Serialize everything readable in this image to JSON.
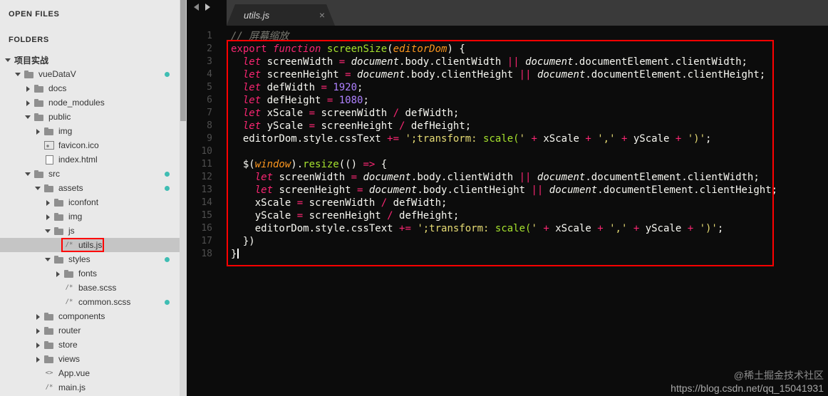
{
  "colors": {
    "annotation_red": "#ff0000",
    "modified_dot_teal": "#3fbdb3",
    "code_bg": "#0c0c0c",
    "sidebar_bg": "#e9e9e9"
  },
  "sidebar": {
    "open_files_label": "OPEN FILES",
    "folders_label": "FOLDERS",
    "tree": [
      {
        "label": "项目实战",
        "level": 0,
        "type": "root",
        "state": "open"
      },
      {
        "label": "vueDataV",
        "level": 1,
        "type": "folder",
        "state": "open",
        "dot": true
      },
      {
        "label": "docs",
        "level": 2,
        "type": "folder",
        "state": "closed"
      },
      {
        "label": "node_modules",
        "level": 2,
        "type": "folder",
        "state": "closed"
      },
      {
        "label": "public",
        "level": 2,
        "type": "folder",
        "state": "open"
      },
      {
        "label": "img",
        "level": 3,
        "type": "folder",
        "state": "closed"
      },
      {
        "label": "favicon.ico",
        "level": 3,
        "type": "file",
        "icon": "image"
      },
      {
        "label": "index.html",
        "level": 3,
        "type": "file",
        "icon": "file"
      },
      {
        "label": "src",
        "level": 2,
        "type": "folder",
        "state": "open",
        "dot": true
      },
      {
        "label": "assets",
        "level": 3,
        "type": "folder",
        "state": "open",
        "dot": true
      },
      {
        "label": "iconfont",
        "level": 4,
        "type": "folder",
        "state": "closed"
      },
      {
        "label": "img",
        "level": 4,
        "type": "folder",
        "state": "closed"
      },
      {
        "label": "js",
        "level": 4,
        "type": "folder",
        "state": "open"
      },
      {
        "label": "utils.js",
        "level": 5,
        "type": "file",
        "icon": "slashstar",
        "selected": true,
        "annotated": true
      },
      {
        "label": "styles",
        "level": 4,
        "type": "folder",
        "state": "open",
        "dot": true
      },
      {
        "label": "fonts",
        "level": 5,
        "type": "folder",
        "state": "closed"
      },
      {
        "label": "base.scss",
        "level": 5,
        "type": "file",
        "icon": "slashstar"
      },
      {
        "label": "common.scss",
        "level": 5,
        "type": "file",
        "icon": "slashstar",
        "dot": true
      },
      {
        "label": "components",
        "level": 3,
        "type": "folder",
        "state": "closed"
      },
      {
        "label": "router",
        "level": 3,
        "type": "folder",
        "state": "closed"
      },
      {
        "label": "store",
        "level": 3,
        "type": "folder",
        "state": "closed"
      },
      {
        "label": "views",
        "level": 3,
        "type": "folder",
        "state": "closed"
      },
      {
        "label": "App.vue",
        "level": 3,
        "type": "file",
        "icon": "angle"
      },
      {
        "label": "main.js",
        "level": 3,
        "type": "file",
        "icon": "slashstar"
      }
    ]
  },
  "editor": {
    "tab": {
      "title": "utils.js",
      "close_glyph": "×"
    },
    "code": {
      "caret_line": 18,
      "lines": [
        [
          [
            "c",
            "// 屏幕缩放"
          ]
        ],
        [
          [
            "k",
            "export "
          ],
          [
            "ki",
            "function "
          ],
          [
            "f",
            "screenSize"
          ],
          [
            "p",
            "("
          ],
          [
            "pr",
            "editorDom"
          ],
          [
            "p",
            ") {"
          ]
        ],
        [
          [
            "p",
            "  "
          ],
          [
            "ki",
            "let"
          ],
          [
            "p",
            " screenWidth "
          ],
          [
            "k",
            "="
          ],
          [
            "p",
            " "
          ],
          [
            "d",
            "document"
          ],
          [
            "p",
            ".body.clientWidth "
          ],
          [
            "k",
            "||"
          ],
          [
            "p",
            " "
          ],
          [
            "d",
            "document"
          ],
          [
            "p",
            ".documentElement.clientWidth;"
          ]
        ],
        [
          [
            "p",
            "  "
          ],
          [
            "ki",
            "let"
          ],
          [
            "p",
            " screenHeight "
          ],
          [
            "k",
            "="
          ],
          [
            "p",
            " "
          ],
          [
            "d",
            "document"
          ],
          [
            "p",
            ".body.clientHeight "
          ],
          [
            "k",
            "||"
          ],
          [
            "p",
            " "
          ],
          [
            "d",
            "document"
          ],
          [
            "p",
            ".documentElement.clientHeight;"
          ]
        ],
        [
          [
            "p",
            "  "
          ],
          [
            "ki",
            "let"
          ],
          [
            "p",
            " defWidth "
          ],
          [
            "k",
            "="
          ],
          [
            "p",
            " "
          ],
          [
            "n",
            "1920"
          ],
          [
            "p",
            ";"
          ]
        ],
        [
          [
            "p",
            "  "
          ],
          [
            "ki",
            "let"
          ],
          [
            "p",
            " defHeight "
          ],
          [
            "k",
            "="
          ],
          [
            "p",
            " "
          ],
          [
            "n",
            "1080"
          ],
          [
            "p",
            ";"
          ]
        ],
        [
          [
            "p",
            "  "
          ],
          [
            "ki",
            "let"
          ],
          [
            "p",
            " xScale "
          ],
          [
            "k",
            "="
          ],
          [
            "p",
            " screenWidth "
          ],
          [
            "k",
            "/"
          ],
          [
            "p",
            " defWidth;"
          ]
        ],
        [
          [
            "p",
            "  "
          ],
          [
            "ki",
            "let"
          ],
          [
            "p",
            " yScale "
          ],
          [
            "k",
            "="
          ],
          [
            "p",
            " screenHeight "
          ],
          [
            "k",
            "/"
          ],
          [
            "p",
            " defHeight;"
          ]
        ],
        [
          [
            "p",
            "  editorDom.style.cssText "
          ],
          [
            "k",
            "+="
          ],
          [
            "p",
            " "
          ],
          [
            "s",
            "';transform: "
          ],
          [
            "f",
            "scale("
          ],
          [
            "s",
            "'"
          ],
          [
            "p",
            " "
          ],
          [
            "k",
            "+"
          ],
          [
            "p",
            " xScale "
          ],
          [
            "k",
            "+"
          ],
          [
            "p",
            " "
          ],
          [
            "s",
            "','"
          ],
          [
            "p",
            " "
          ],
          [
            "k",
            "+"
          ],
          [
            "p",
            " yScale "
          ],
          [
            "k",
            "+"
          ],
          [
            "p",
            " "
          ],
          [
            "s",
            "')'"
          ],
          [
            "p",
            ";"
          ]
        ],
        [],
        [
          [
            "p",
            "  $("
          ],
          [
            "pr",
            "window"
          ],
          [
            "p",
            ")."
          ],
          [
            "f",
            "resize"
          ],
          [
            "p",
            "(() "
          ],
          [
            "k",
            "=>"
          ],
          [
            "p",
            " {"
          ]
        ],
        [
          [
            "p",
            "    "
          ],
          [
            "ki",
            "let"
          ],
          [
            "p",
            " screenWidth "
          ],
          [
            "k",
            "="
          ],
          [
            "p",
            " "
          ],
          [
            "d",
            "document"
          ],
          [
            "p",
            ".body.clientWidth "
          ],
          [
            "k",
            "||"
          ],
          [
            "p",
            " "
          ],
          [
            "d",
            "document"
          ],
          [
            "p",
            ".documentElement.clientWidth;"
          ]
        ],
        [
          [
            "p",
            "    "
          ],
          [
            "ki",
            "let"
          ],
          [
            "p",
            " screenHeight "
          ],
          [
            "k",
            "="
          ],
          [
            "p",
            " "
          ],
          [
            "d",
            "document"
          ],
          [
            "p",
            ".body.clientHeight "
          ],
          [
            "k",
            "||"
          ],
          [
            "p",
            " "
          ],
          [
            "d",
            "document"
          ],
          [
            "p",
            ".documentElement.clientHeight;"
          ]
        ],
        [
          [
            "p",
            "    xScale "
          ],
          [
            "k",
            "="
          ],
          [
            "p",
            " screenWidth "
          ],
          [
            "k",
            "/"
          ],
          [
            "p",
            " defWidth;"
          ]
        ],
        [
          [
            "p",
            "    yScale "
          ],
          [
            "k",
            "="
          ],
          [
            "p",
            " screenHeight "
          ],
          [
            "k",
            "/"
          ],
          [
            "p",
            " defHeight;"
          ]
        ],
        [
          [
            "p",
            "    editorDom.style.cssText "
          ],
          [
            "k",
            "+="
          ],
          [
            "p",
            " "
          ],
          [
            "s",
            "';transform: "
          ],
          [
            "f",
            "scale("
          ],
          [
            "s",
            "'"
          ],
          [
            "p",
            " "
          ],
          [
            "k",
            "+"
          ],
          [
            "p",
            " xScale "
          ],
          [
            "k",
            "+"
          ],
          [
            "p",
            " "
          ],
          [
            "s",
            "','"
          ],
          [
            "p",
            " "
          ],
          [
            "k",
            "+"
          ],
          [
            "p",
            " yScale "
          ],
          [
            "k",
            "+"
          ],
          [
            "p",
            " "
          ],
          [
            "s",
            "')'"
          ],
          [
            "p",
            ";"
          ]
        ],
        [
          [
            "p",
            "  })"
          ]
        ],
        [
          [
            "p",
            "}"
          ]
        ]
      ]
    }
  },
  "watermark": {
    "line1": "@稀土掘金技术社区",
    "line2": "https://blog.csdn.net/qq_15041931"
  }
}
